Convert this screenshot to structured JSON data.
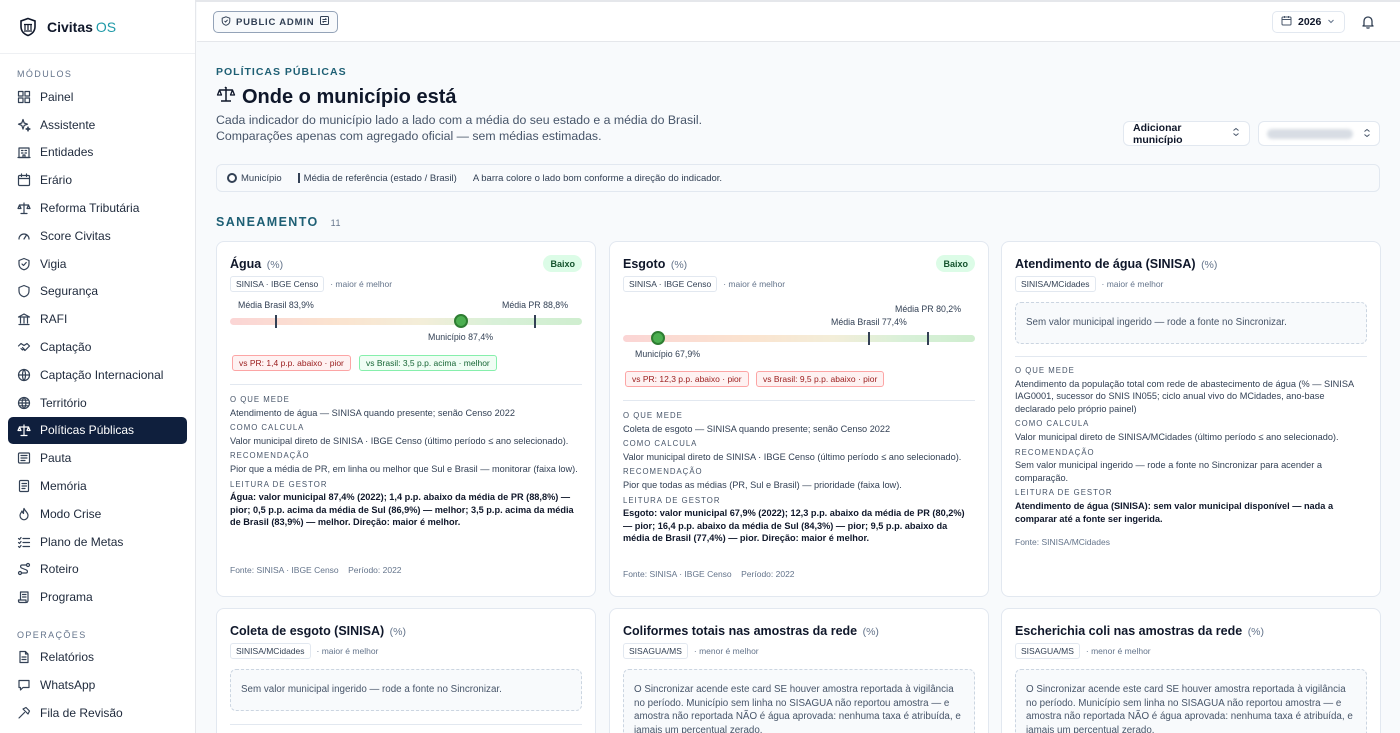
{
  "brand": {
    "name": "Civitas",
    "suffix": "OS"
  },
  "sidebar": {
    "modules_label": "MÓDULOS",
    "items": [
      {
        "label": "Painel",
        "icon": "grid-icon"
      },
      {
        "label": "Assistente",
        "icon": "sparkles-icon"
      },
      {
        "label": "Entidades",
        "icon": "building-icon"
      },
      {
        "label": "Erário",
        "icon": "calendar-icon"
      },
      {
        "label": "Reforma Tributária",
        "icon": "scale-icon"
      },
      {
        "label": "Score Civitas",
        "icon": "gauge-icon"
      },
      {
        "label": "Vigia",
        "icon": "shield-icon"
      },
      {
        "label": "Segurança",
        "icon": "shield-outline-icon"
      },
      {
        "label": "RAFI",
        "icon": "bank-icon"
      },
      {
        "label": "Captação",
        "icon": "handshake-icon"
      },
      {
        "label": "Captação Internacional",
        "icon": "globe-icon"
      },
      {
        "label": "Território",
        "icon": "globe-grid-icon"
      },
      {
        "label": "Políticas Públicas",
        "icon": "scale-icon",
        "active": true
      },
      {
        "label": "Pauta",
        "icon": "newspaper-icon"
      },
      {
        "label": "Memória",
        "icon": "notebook-icon"
      },
      {
        "label": "Modo Crise",
        "icon": "flame-icon"
      },
      {
        "label": "Plano de Metas",
        "icon": "checklist-icon"
      },
      {
        "label": "Roteiro",
        "icon": "route-icon"
      },
      {
        "label": "Programa",
        "icon": "scroll-icon"
      }
    ],
    "ops_label": "OPERAÇÕES",
    "ops_items": [
      {
        "label": "Relatórios",
        "icon": "document-icon"
      },
      {
        "label": "WhatsApp",
        "icon": "chat-icon"
      },
      {
        "label": "Fila de Revisão",
        "icon": "hammer-icon"
      }
    ]
  },
  "topbar": {
    "role_label": "PUBLIC ADMIN",
    "year": "2026"
  },
  "page": {
    "kicker": "POLÍTICAS PÚBLICAS",
    "title": "Onde o município está",
    "description": "Cada indicador do município lado a lado com a média do seu estado e a média do Brasil. Comparações apenas com agregado oficial — sem médias estimadas.",
    "add_button": "Adicionar município",
    "legend": {
      "municipio": "Município",
      "referencia": "Média de referência (estado / Brasil)",
      "note": "A barra colore o lado bom conforme a direção do indicador."
    },
    "section": {
      "title": "SANEAMENTO",
      "count": "11"
    }
  },
  "labels": {
    "o_que_mede": "O QUE MEDE",
    "como_calcula": "COMO CALCULA",
    "recomendacao": "RECOMENDAÇÃO",
    "leitura": "LEITURA DE GESTOR"
  },
  "cards": {
    "agua": {
      "title": "Água",
      "unit": "(%)",
      "badge": "Baixo",
      "source": "SINISA · IBGE Censo",
      "direction": "· maior é melhor",
      "media_brasil": "Média Brasil 83,9%",
      "media_pr": "Média PR 88,8%",
      "municipio": "Município 87,4%",
      "values": {
        "municipio": 87.4,
        "media_brasil": 83.9,
        "media_pr": 88.8
      },
      "cmp1": "vs PR: 1,4 p.p. abaixo · pior",
      "cmp2": "vs Brasil: 3,5 p.p. acima · melhor",
      "o_que_mede": "Atendimento de água — SINISA quando presente; senão Censo 2022",
      "como_calcula": "Valor municipal direto de SINISA · IBGE Censo (último período ≤ ano selecionado).",
      "recomendacao": "Pior que a média de PR, em linha ou melhor que Sul e Brasil — monitorar (faixa low).",
      "leitura": "Água: valor municipal 87,4% (2022); 1,4 p.p. abaixo da média de PR (88,8%) — pior; 0,5 p.p. acima da média de Sul (86,9%) — melhor; 3,5 p.p. acima da média de Brasil (83,9%) — melhor. Direção: maior é melhor.",
      "fonte": "Fonte: SINISA · IBGE Censo",
      "periodo": "Período: 2022"
    },
    "esgoto": {
      "title": "Esgoto",
      "unit": "(%)",
      "badge": "Baixo",
      "source": "SINISA · IBGE Censo",
      "direction": "· maior é melhor",
      "media_pr": "Média PR 80,2%",
      "media_brasil": "Média Brasil 77,4%",
      "municipio": "Município 67,9%",
      "values": {
        "municipio": 67.9,
        "media_brasil": 77.4,
        "media_pr": 80.2
      },
      "cmp1": "vs PR: 12,3 p.p. abaixo · pior",
      "cmp2": "vs Brasil: 9,5 p.p. abaixo · pior",
      "o_que_mede": "Coleta de esgoto — SINISA quando presente; senão Censo 2022",
      "como_calcula": "Valor municipal direto de SINISA · IBGE Censo (último período ≤ ano selecionado).",
      "recomendacao": "Pior que todas as médias (PR, Sul e Brasil) — prioridade (faixa low).",
      "leitura": "Esgoto: valor municipal 67,9% (2022); 12,3 p.p. abaixo da média de PR (80,2%) — pior; 16,4 p.p. abaixo da média de Sul (84,3%) — pior; 9,5 p.p. abaixo da média de Brasil (77,4%) — pior. Direção: maior é melhor.",
      "fonte": "Fonte: SINISA · IBGE Censo",
      "periodo": "Período: 2022"
    },
    "atendimento": {
      "title": "Atendimento de água (SINISA)",
      "unit": "(%)",
      "source": "SINISA/MCidades",
      "direction": "· maior é melhor",
      "empty": "Sem valor municipal ingerido — rode a fonte no Sincronizar.",
      "o_que_mede": "Atendimento da população total com rede de abastecimento de água (% — SINISA IAG0001, sucessor do SNIS IN055; ciclo anual vivo do MCidades, ano-base declarado pelo próprio painel)",
      "como_calcula": "Valor municipal direto de SINISA/MCidades (último período ≤ ano selecionado).",
      "recomendacao": "Sem valor municipal ingerido — rode a fonte no Sincronizar para acender a comparação.",
      "leitura": "Atendimento de água (SINISA): sem valor municipal disponível — nada a comparar até a fonte ser ingerida.",
      "fonte": "Fonte: SINISA/MCidades"
    },
    "coleta": {
      "title": "Coleta de esgoto (SINISA)",
      "unit": "(%)",
      "source": "SINISA/MCidades",
      "direction": "· maior é melhor",
      "empty": "Sem valor municipal ingerido — rode a fonte no Sincronizar."
    },
    "coliformes": {
      "title": "Coliformes totais nas amostras da rede",
      "unit": "(%)",
      "source": "SISAGUA/MS",
      "direction": "· menor é melhor",
      "empty": "O Sincronizar acende este card SE houver amostra reportada à vigilância no período. Município sem linha no SISAGUA não reportou amostra — e amostra não reportada NÃO é água aprovada: nenhuma taxa é atribuída, e jamais um percentual zerado."
    },
    "ecoli": {
      "title": "Escherichia coli nas amostras da rede",
      "unit": "(%)",
      "source": "SISAGUA/MS",
      "direction": "· menor é melhor",
      "empty": "O Sincronizar acende este card SE houver amostra reportada à vigilância no período. Município sem linha no SISAGUA não reportou amostra — e amostra não reportada NÃO é água aprovada: nenhuma taxa é atribuída, e jamais um percentual zerado."
    }
  },
  "colors": {
    "accent": "#1e5f74",
    "active_nav": "#0f1f3d",
    "good": "#4caf50",
    "bad": "#fca5a5"
  }
}
